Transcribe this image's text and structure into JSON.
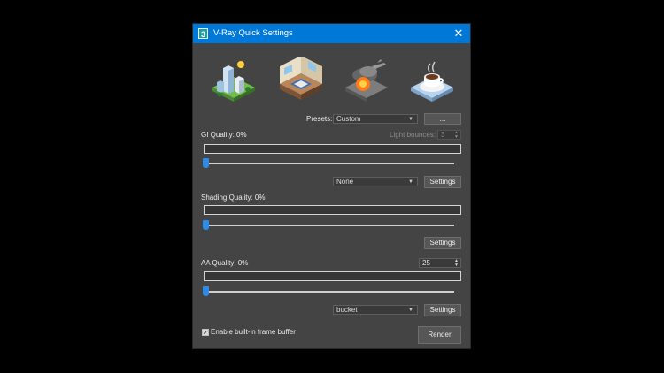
{
  "window": {
    "app_icon_text": "3",
    "title": "V-Ray Quick Settings",
    "close_glyph": "✕"
  },
  "scenes": [
    {
      "icon": "city-exterior-icon"
    },
    {
      "icon": "room-interior-icon"
    },
    {
      "icon": "explosion-effects-icon"
    },
    {
      "icon": "product-coffee-cup-icon"
    }
  ],
  "presets": {
    "label": "Presets:",
    "value": "Custom",
    "more_label": "..."
  },
  "gi": {
    "label": "GI Quality: 0%",
    "quality_percent": 0,
    "light_bounces_label": "Light bounces:",
    "light_bounces_value": "3",
    "secondary_value": "None",
    "settings_label": "Settings"
  },
  "shading": {
    "label": "Shading Quality: 0%",
    "quality_percent": 0,
    "settings_label": "Settings"
  },
  "aa": {
    "label": "AA Quality: 0%",
    "quality_percent": 0,
    "spinner_value": "25",
    "sampler_value": "bucket",
    "settings_label": "Settings"
  },
  "footer": {
    "vfb_checkbox_label": "Enable built-in frame buffer",
    "vfb_checked": true,
    "render_label": "Render"
  },
  "colors": {
    "titlebar": "#0078d7",
    "accent": "#2f8be8",
    "panel": "#444444"
  }
}
